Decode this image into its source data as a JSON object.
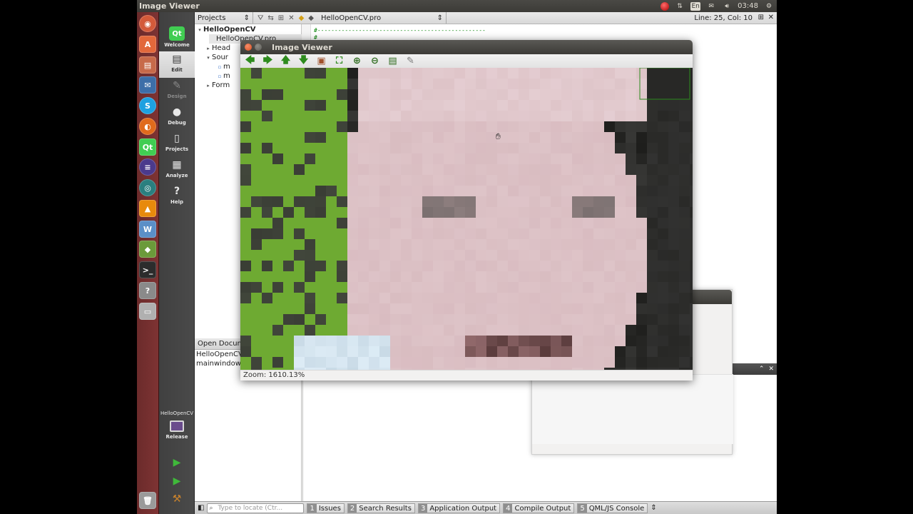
{
  "top_panel": {
    "title": "Image Viewer",
    "keyboard_layout": "En",
    "time": "03:48"
  },
  "launcher": {
    "apps": [
      "dash",
      "software-center",
      "files",
      "thunderbird",
      "skype",
      "firefox",
      "qt-creator",
      "eclipse",
      "globe",
      "vlc",
      "writer",
      "stack",
      "terminal",
      "unknown",
      "drive"
    ]
  },
  "modes": [
    {
      "label": "Welcome",
      "icon": "qt-logo-icon",
      "state": "normal"
    },
    {
      "label": "Edit",
      "icon": "edit-document-icon",
      "state": "active"
    },
    {
      "label": "Design",
      "icon": "design-pencil-icon",
      "state": "disabled"
    },
    {
      "label": "Debug",
      "icon": "debug-bug-icon",
      "state": "normal"
    },
    {
      "label": "Projects",
      "icon": "projects-wrench-icon",
      "state": "normal"
    },
    {
      "label": "Analyze",
      "icon": "analyze-monitor-icon",
      "state": "normal"
    },
    {
      "label": "Help",
      "icon": "help-question-icon",
      "state": "normal"
    }
  ],
  "kit": {
    "project": "HelloOpenCV",
    "build": "Release"
  },
  "toolbar": {
    "projects_label": "Projects",
    "file_label": "HelloOpenCV.pro",
    "position": "Line: 25, Col: 10"
  },
  "project_tree": [
    {
      "label": "HelloOpenCV",
      "arrow": "▾",
      "indent": 0,
      "bold": true
    },
    {
      "label": "HelloOpenCV.pro",
      "arrow": "",
      "indent": 1,
      "bold": false
    },
    {
      "label": "Head",
      "arrow": "▸",
      "indent": 1,
      "bold": false
    },
    {
      "label": "Sour",
      "arrow": "▾",
      "indent": 1,
      "bold": false
    },
    {
      "label": "m",
      "arrow": "",
      "indent": 2,
      "bold": false
    },
    {
      "label": "m",
      "arrow": "",
      "indent": 2,
      "bold": false
    },
    {
      "label": "Form",
      "arrow": "▸",
      "indent": 1,
      "bold": false
    }
  ],
  "editor": {
    "comment_line_1": "#-------------------------------------------------",
    "comment_line_2": "#"
  },
  "open_documents": {
    "header": "Open Docum",
    "items": [
      "HelloOpenCV",
      "mainwindow."
    ]
  },
  "statusbar": {
    "locator_placeholder": "Type to locate (Ctr...",
    "tabs": [
      {
        "num": "1",
        "label": "Issues"
      },
      {
        "num": "2",
        "label": "Search Results"
      },
      {
        "num": "3",
        "label": "Application Output"
      },
      {
        "num": "4",
        "label": "Compile Output"
      },
      {
        "num": "5",
        "label": "QML/JS Console"
      }
    ]
  },
  "image_viewer": {
    "title": "Image Viewer",
    "tools": [
      {
        "name": "back-arrow-icon",
        "glyph": "🡄",
        "color": "#2e8b1e"
      },
      {
        "name": "forward-arrow-icon",
        "glyph": "🡆",
        "color": "#2e8b1e"
      },
      {
        "name": "up-arrow-icon",
        "glyph": "🡅",
        "color": "#2e8b1e"
      },
      {
        "name": "down-arrow-icon",
        "glyph": "🡇",
        "color": "#2e8b1e"
      },
      {
        "name": "open-image-icon",
        "glyph": "▣",
        "color": "#a0522d"
      },
      {
        "name": "fit-window-icon",
        "glyph": "⛶",
        "color": "#2e8b1e"
      },
      {
        "name": "zoom-in-icon",
        "glyph": "⊕",
        "color": "#2e6b1e"
      },
      {
        "name": "zoom-out-icon",
        "glyph": "⊖",
        "color": "#2e6b1e"
      },
      {
        "name": "save-icon",
        "glyph": "▤",
        "color": "#2e6b1e"
      },
      {
        "name": "brush-icon",
        "glyph": "✎",
        "color": "#777777"
      }
    ],
    "zoom_status": "Zoom: 1610.13%"
  },
  "colors": {
    "launcher_bg": "#7e3333",
    "panel_bg": "#3c3b37",
    "accent_green": "#2e8b1e"
  }
}
